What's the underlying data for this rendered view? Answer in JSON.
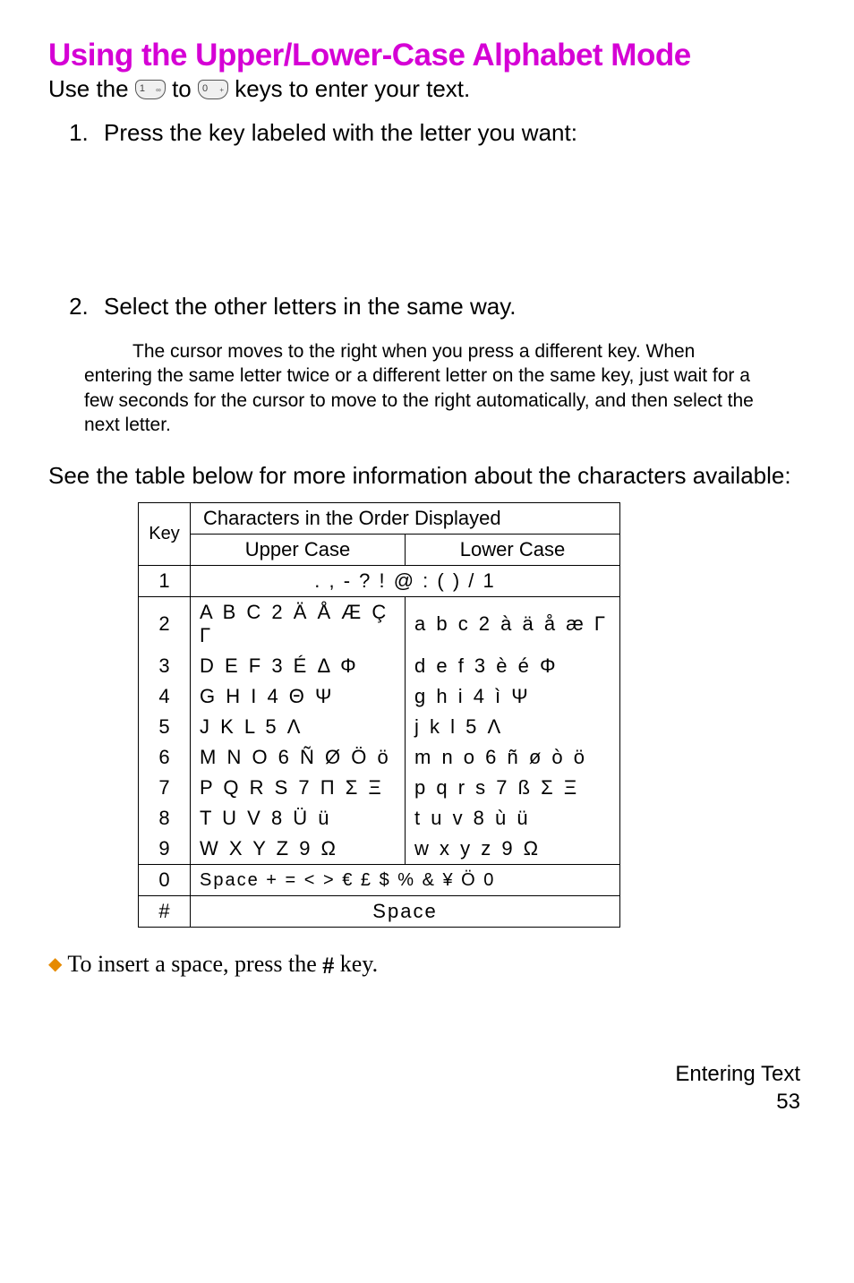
{
  "title": "Using the Upper/Lower-Case Alphabet Mode",
  "intro_prefix": "Use the ",
  "intro_mid": " to ",
  "intro_suffix": " keys to enter your text.",
  "key1_label": "1",
  "key1_sub": "∞",
  "key0_label": "0",
  "key0_sub": "+",
  "step1": "Press the key labeled with the letter you want:",
  "step2": "Select the other letters in the same way.",
  "note": "The cursor moves to the right when you press a different key. When entering the same letter twice or a different letter on the same key, just wait for a few seconds for the cursor to move to the right automatically, and then select the next letter.",
  "see_table": "See the table below for more information about the characters available:",
  "table": {
    "hdr_top": "Characters in the Order Displayed",
    "hdr_key": "Key",
    "hdr_uc": "Upper Case",
    "hdr_lc": "Lower Case",
    "rows": [
      {
        "key": "1",
        "upper": ". , - ? ! @ : ( ) / 1",
        "lower": "",
        "span": true
      },
      {
        "key": "2",
        "upper": "A B C 2 Ä Å Æ Ç Γ",
        "lower": "a b c 2 à ä å æ Γ"
      },
      {
        "key": "3",
        "upper": "D E F 3 É Δ Φ",
        "lower": "d e f 3 è é Φ"
      },
      {
        "key": "4",
        "upper": "G H I 4 Θ Ψ",
        "lower": "g h i 4 ì Ψ"
      },
      {
        "key": "5",
        "upper": "J K L 5 Λ",
        "lower": "j k l 5 Λ"
      },
      {
        "key": "6",
        "upper": "M N O 6 Ñ Ø Ö ö",
        "lower": "m n o 6 ñ ø ò ö"
      },
      {
        "key": "7",
        "upper": "P Q R S 7 Π Σ Ξ",
        "lower": "p q r s 7 ß Σ Ξ"
      },
      {
        "key": "8",
        "upper": "T U V 8 Ü ü",
        "lower": "t u v 8 ù ü"
      },
      {
        "key": "9",
        "upper": "W X Y Z 9 Ω",
        "lower": "w x y z 9 Ω"
      },
      {
        "key": "0",
        "upper": "Space  +  =  <  >  €  £  $  %  &  ¥  Ö  0",
        "lower": "",
        "span": true
      },
      {
        "key": "#",
        "upper": "Space",
        "lower": "",
        "span": true
      }
    ]
  },
  "insert_prefix": "To insert a space, press the ",
  "insert_suffix": " key.",
  "hash_symbol": "#",
  "footer_section": "Entering Text",
  "footer_page": "53"
}
